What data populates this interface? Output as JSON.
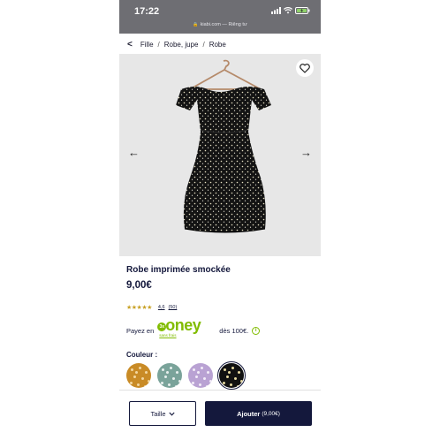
{
  "status_bar": {
    "time": "17:22",
    "url": "kiabi.com — Riêng tư"
  },
  "breadcrumb": [
    "Fille",
    "Robe, jupe",
    "Robe"
  ],
  "product": {
    "title": "Robe imprimée smockée",
    "price": "9,00€",
    "rating": {
      "stars": 4.6,
      "value": "4,6",
      "count": "(50)"
    }
  },
  "payment": {
    "prefix": "Payez en",
    "badge": "3x",
    "brand": "oney",
    "sub": "sans frais",
    "suffix": "dès 100€.",
    "info_icon": "i"
  },
  "colors": {
    "label": "Couleur :",
    "swatches": [
      {
        "name": "mustard",
        "base": "#c98b26",
        "dot": "#f3d7a0",
        "selected": false
      },
      {
        "name": "sage",
        "base": "#7aa39a",
        "dot": "#e8f0ee",
        "selected": false
      },
      {
        "name": "lilac",
        "base": "#b9a2d3",
        "dot": "#f2ecf8",
        "selected": false
      },
      {
        "name": "black",
        "base": "#111111",
        "dot": "#e6d9a0",
        "selected": true
      }
    ]
  },
  "actions": {
    "size_label": "Taille",
    "add_label": "Ajouter",
    "add_price": "(9,00€)"
  },
  "theme": {
    "navy": "#14183c",
    "oney_green": "#81bc00",
    "star": "#c9a227"
  }
}
